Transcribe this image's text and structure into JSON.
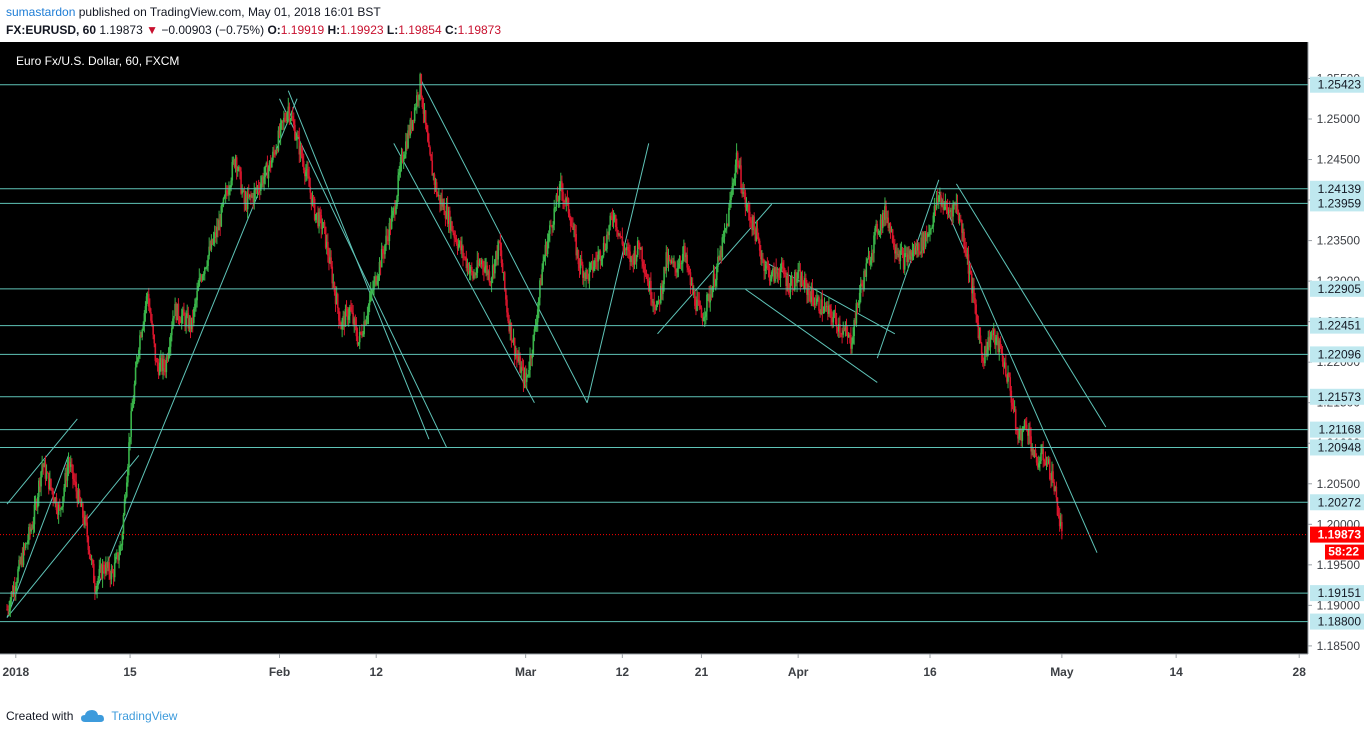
{
  "header": {
    "author": "sumastardon",
    "published": "published on TradingView.com, May 01, 2018 16:01 BST",
    "symbol": "FX:EURUSD, 60",
    "last": "1.19873",
    "change": "−0.00903 (−0.75%)",
    "o_label": "O:",
    "o_value": "1.19919",
    "h_label": "H:",
    "h_value": "1.19923",
    "l_label": "L:",
    "l_value": "1.19854",
    "c_label": "C:",
    "c_value": "1.19873"
  },
  "footer": {
    "created_with": "Created with",
    "brand": "TradingView"
  },
  "colors": {
    "background": "#000000",
    "up": "#3ab54a",
    "down": "#d8152c",
    "line": "#5fc4b8",
    "price": "#ff0000",
    "label_bg": "#bfe8ef"
  },
  "chart_data": {
    "type": "candlestick",
    "title": "Euro Fx/U.S. Dollar, 60, FXCM",
    "ylim": [
      1.184,
      1.2595
    ],
    "x_range_days": [
      0,
      148
    ],
    "y_ticks": [
      "1.18500",
      "1.19000",
      "1.19500",
      "1.20000",
      "1.20500",
      "1.21000",
      "1.21500",
      "1.22000",
      "1.22500",
      "1.23000",
      "1.23500",
      "1.24000",
      "1.24500",
      "1.25000",
      "1.25500"
    ],
    "y_tick_values": [
      1.185,
      1.19,
      1.195,
      1.2,
      1.205,
      1.21,
      1.215,
      1.22,
      1.225,
      1.23,
      1.235,
      1.24,
      1.245,
      1.25,
      1.255
    ],
    "x_ticks": [
      {
        "label": "2018",
        "day": 1
      },
      {
        "label": "15",
        "day": 14
      },
      {
        "label": "Feb",
        "day": 31
      },
      {
        "label": "12",
        "day": 42
      },
      {
        "label": "Mar",
        "day": 59
      },
      {
        "label": "12",
        "day": 70
      },
      {
        "label": "21",
        "day": 79
      },
      {
        "label": "Apr",
        "day": 90
      },
      {
        "label": "16",
        "day": 105
      },
      {
        "label": "May",
        "day": 120
      },
      {
        "label": "14",
        "day": 133
      },
      {
        "label": "28",
        "day": 147
      }
    ],
    "horizontal_levels": [
      "1.25423",
      "1.24139",
      "1.23959",
      "1.22905",
      "1.22451",
      "1.22096",
      "1.21573",
      "1.21168",
      "1.20948",
      "1.20272",
      "1.19151",
      "1.18800"
    ],
    "current_price": "1.19873",
    "countdown": "58:22",
    "price_path": [
      [
        0,
        1.1895
      ],
      [
        3,
        1.2005
      ],
      [
        4,
        1.2075
      ],
      [
        6,
        1.2015
      ],
      [
        7,
        1.2078
      ],
      [
        9,
        1.1995
      ],
      [
        10,
        1.1925
      ],
      [
        11,
        1.1948
      ],
      [
        12,
        1.1938
      ],
      [
        13,
        1.1975
      ],
      [
        14,
        1.2115
      ],
      [
        15,
        1.2225
      ],
      [
        16,
        1.2285
      ],
      [
        17,
        1.2195
      ],
      [
        18,
        1.2195
      ],
      [
        19,
        1.2265
      ],
      [
        21,
        1.2245
      ],
      [
        22,
        1.2305
      ],
      [
        24,
        1.2365
      ],
      [
        26,
        1.2455
      ],
      [
        27,
        1.2395
      ],
      [
        28,
        1.2405
      ],
      [
        30,
        1.2445
      ],
      [
        32,
        1.2515
      ],
      [
        34,
        1.2435
      ],
      [
        35,
        1.2385
      ],
      [
        36,
        1.2365
      ],
      [
        38,
        1.2245
      ],
      [
        39,
        1.2265
      ],
      [
        40,
        1.2225
      ],
      [
        42,
        1.2305
      ],
      [
        44,
        1.2385
      ],
      [
        45,
        1.2455
      ],
      [
        46,
        1.2495
      ],
      [
        47,
        1.2545
      ],
      [
        48,
        1.2455
      ],
      [
        49,
        1.2405
      ],
      [
        50,
        1.2385
      ],
      [
        51,
        1.2355
      ],
      [
        53,
        1.2305
      ],
      [
        54,
        1.2325
      ],
      [
        55,
        1.2305
      ],
      [
        56,
        1.2345
      ],
      [
        57,
        1.2255
      ],
      [
        58,
        1.2205
      ],
      [
        59,
        1.2175
      ],
      [
        60,
        1.2235
      ],
      [
        61,
        1.2325
      ],
      [
        62,
        1.2375
      ],
      [
        63,
        1.2415
      ],
      [
        64,
        1.2385
      ],
      [
        65,
        1.2325
      ],
      [
        66,
        1.2305
      ],
      [
        68,
        1.2345
      ],
      [
        69,
        1.2385
      ],
      [
        70,
        1.2345
      ],
      [
        71,
        1.2325
      ],
      [
        72,
        1.2345
      ],
      [
        73,
        1.2295
      ],
      [
        74,
        1.2265
      ],
      [
        75,
        1.2325
      ],
      [
        76,
        1.2315
      ],
      [
        77,
        1.2335
      ],
      [
        78,
        1.2285
      ],
      [
        79,
        1.2255
      ],
      [
        80,
        1.2285
      ],
      [
        81,
        1.2325
      ],
      [
        82,
        1.2375
      ],
      [
        83,
        1.2455
      ],
      [
        84,
        1.2395
      ],
      [
        85,
        1.2365
      ],
      [
        86,
        1.2325
      ],
      [
        87,
        1.2305
      ],
      [
        88,
        1.2315
      ],
      [
        89,
        1.2295
      ],
      [
        90,
        1.2305
      ],
      [
        92,
        1.2275
      ],
      [
        94,
        1.2255
      ],
      [
        96,
        1.2225
      ],
      [
        97,
        1.2285
      ],
      [
        98,
        1.2325
      ],
      [
        99,
        1.2365
      ],
      [
        100,
        1.2385
      ],
      [
        101,
        1.2345
      ],
      [
        102,
        1.2325
      ],
      [
        104,
        1.2345
      ],
      [
        105,
        1.2365
      ],
      [
        106,
        1.2405
      ],
      [
        107,
        1.2385
      ],
      [
        108,
        1.2395
      ],
      [
        109,
        1.2345
      ],
      [
        110,
        1.2275
      ],
      [
        111,
        1.2205
      ],
      [
        112,
        1.2235
      ],
      [
        113,
        1.2215
      ],
      [
        114,
        1.2175
      ],
      [
        115,
        1.2105
      ],
      [
        116,
        1.2125
      ],
      [
        117,
        1.2075
      ],
      [
        118,
        1.2085
      ],
      [
        119,
        1.2055
      ],
      [
        120,
        1.19873
      ]
    ],
    "trend_lines": [
      [
        [
          0,
          1.1885
        ],
        [
          7,
          1.2085
        ]
      ],
      [
        [
          0,
          1.2025
        ],
        [
          8,
          1.213
        ]
      ],
      [
        [
          0,
          1.1885
        ],
        [
          15,
          1.2085
        ]
      ],
      [
        [
          10,
          1.1915
        ],
        [
          33,
          1.2525
        ]
      ],
      [
        [
          32,
          1.2535
        ],
        [
          48,
          1.2105
        ]
      ],
      [
        [
          31,
          1.2525
        ],
        [
          50,
          1.2095
        ]
      ],
      [
        [
          44,
          1.247
        ],
        [
          60,
          1.215
        ]
      ],
      [
        [
          47,
          1.255
        ],
        [
          66,
          1.215
        ]
      ],
      [
        [
          66,
          1.215
        ],
        [
          73,
          1.247
        ]
      ],
      [
        [
          74,
          1.2235
        ],
        [
          87,
          1.2395
        ]
      ],
      [
        [
          86,
          1.2325
        ],
        [
          101,
          1.2235
        ]
      ],
      [
        [
          84,
          1.229
        ],
        [
          99,
          1.2175
        ]
      ],
      [
        [
          99,
          1.2205
        ],
        [
          106,
          1.2425
        ]
      ],
      [
        [
          106,
          1.241
        ],
        [
          124,
          1.1965
        ]
      ],
      [
        [
          108,
          1.242
        ],
        [
          125,
          1.212
        ]
      ]
    ]
  }
}
